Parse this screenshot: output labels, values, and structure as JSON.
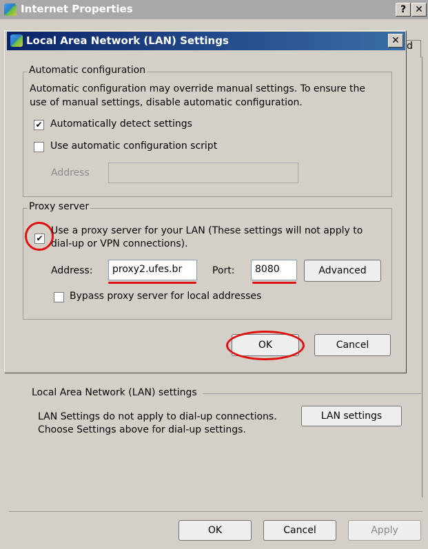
{
  "back_window": {
    "title": "Internet Properties",
    "help_btn": "?",
    "close_btn": "✕",
    "tab_stub": "d",
    "lan_group_label": "Local Area Network (LAN) settings",
    "lan_desc_line1": "LAN Settings do not apply to dial-up connections.",
    "lan_desc_line2": "Choose Settings above for dial-up settings.",
    "lan_settings_btn": "LAN settings",
    "ok_btn": "OK",
    "cancel_btn": "Cancel",
    "apply_btn": "Apply"
  },
  "dialog": {
    "title": "Local Area Network (LAN) Settings",
    "close_btn": "✕",
    "auto_config": {
      "label": "Automatic configuration",
      "desc_line1": "Automatic configuration may override manual settings.  To ensure the",
      "desc_line2": "use of manual settings, disable automatic configuration.",
      "detect_label": "Automatically detect settings",
      "detect_checked": "✔",
      "script_label": "Use automatic configuration script",
      "address_label": "Address",
      "address_value": ""
    },
    "proxy": {
      "label": "Proxy server",
      "use_proxy_line1": "Use a proxy server for your LAN (These settings will not apply to",
      "use_proxy_line2": "dial-up or VPN connections).",
      "use_proxy_checked": "✔",
      "address_label": "Address:",
      "address_value": "proxy2.ufes.br",
      "port_label": "Port:",
      "port_value": "8080",
      "advanced_btn": "Advanced",
      "bypass_label": "Bypass proxy server for local addresses"
    },
    "ok_btn": "OK",
    "cancel_btn": "Cancel"
  },
  "colors": {
    "title_active": "#0a246a",
    "title_inactive": "#a8a8a8",
    "annotation_red": "#e01010"
  }
}
